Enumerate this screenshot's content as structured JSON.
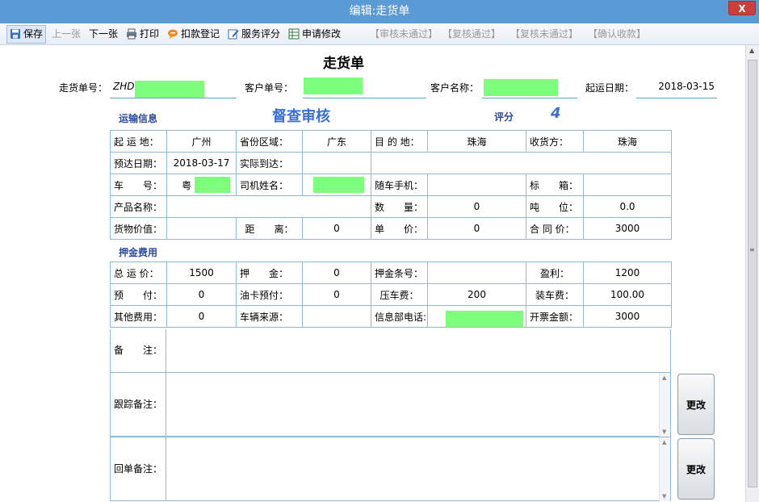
{
  "window": {
    "title": "编辑:走货单",
    "close_label": "X"
  },
  "toolbar": {
    "save": "保存",
    "prev": "上一张",
    "next": "下一张",
    "print": "打印",
    "deduct": "扣款登记",
    "rate": "服务评分",
    "apply_edit": "申请修改",
    "audit_fail": "【审核未通过】",
    "recheck_pass": "【复核通过】",
    "recheck_fail": "【复核未通过】",
    "confirm_pay": "【确认收款】"
  },
  "form": {
    "title": "走货单",
    "waybill_no_label": "走货单号：",
    "waybill_no_value": "ZHD",
    "customer_no_label": "客户单号：",
    "customer_name_label": "客户名称：",
    "ship_date_label": "起运日期：",
    "ship_date_value": "2018-03-15",
    "transport_section": "运输信息",
    "audit_status": "督查审核",
    "score_label": "评分",
    "score_value": "4",
    "deposit_section": "押金费用"
  },
  "transport": {
    "r1": [
      "起 运 地：",
      "广州",
      "省份区域：",
      "广东",
      "目 的 地：",
      "珠海",
      "收货方：",
      "珠海"
    ],
    "r2": [
      "预达日期：",
      "2018-03-17",
      "实际到达：",
      ""
    ],
    "r3": [
      "车　　号：",
      "粤",
      "司机姓名：",
      "",
      "随车手机：",
      "",
      "标　　箱：",
      ""
    ],
    "r4": [
      "产品名称：",
      "",
      "数　　量：",
      "0",
      "吨　　位：",
      "0.0"
    ],
    "r5": [
      "货物价值：",
      "",
      "距　　离：",
      "0",
      "单　　价：",
      "0",
      "合 同 价：",
      "3000"
    ]
  },
  "deposit": {
    "r1": [
      "总 运 价：",
      "1500",
      "押　　金：",
      "0",
      "押金条号：",
      "",
      "盈利：",
      "1200"
    ],
    "r2": [
      "预　　付：",
      "0",
      "油卡预付：",
      "0",
      "压车费：",
      "200",
      "装车费：",
      "100.00"
    ],
    "r3": [
      "其他费用：",
      "0",
      "车辆来源：",
      "",
      "信息部电话:",
      "",
      "开票金额：",
      "3000"
    ]
  },
  "notes": {
    "remark_label": "备　　注：",
    "follow_label": "跟踪备注：",
    "return_label": "回单备注：",
    "change_label": "更改"
  },
  "colors": {
    "titlebar": "#5b9bd5",
    "accent": "#3a6fd8",
    "grid_border": "#8fbad9",
    "redaction": "#7dff7d"
  }
}
